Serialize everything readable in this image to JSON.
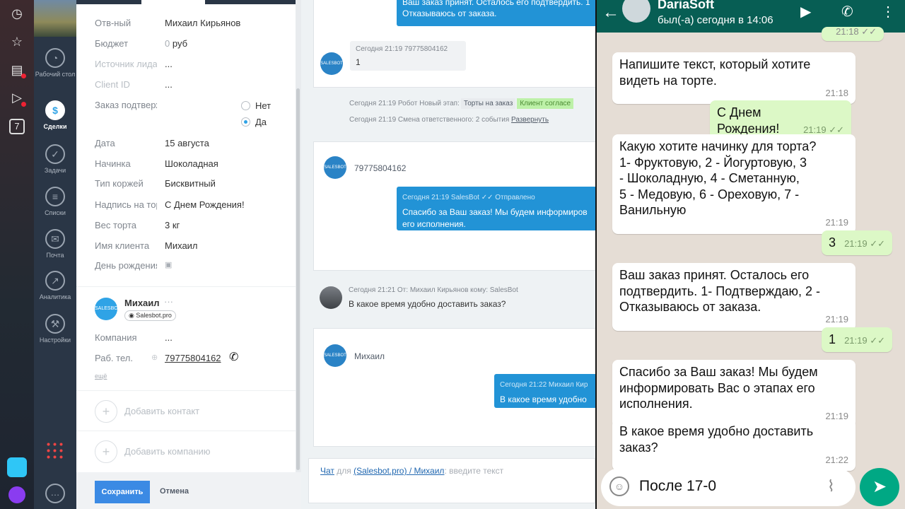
{
  "os_bar": {
    "icons": [
      "clock-icon",
      "star-icon",
      "news-icon",
      "play-icon",
      "calendar-icon"
    ],
    "calendar_day": "7"
  },
  "nav": {
    "items": [
      {
        "name": "desktop",
        "label": "Рабочий стол",
        "icon": "gauge-icon"
      },
      {
        "name": "deals",
        "label": "Сделки",
        "icon": "dollar-icon",
        "active": true
      },
      {
        "name": "tasks",
        "label": "Задачи",
        "icon": "check-icon"
      },
      {
        "name": "lists",
        "label": "Списки",
        "icon": "list-icon"
      },
      {
        "name": "mail",
        "label": "Почта",
        "icon": "envelope-icon"
      },
      {
        "name": "analytics",
        "label": "Аналитика",
        "icon": "chart-icon"
      },
      {
        "name": "settings",
        "label": "Настройки",
        "icon": "wrench-icon"
      }
    ]
  },
  "form": {
    "responsible": {
      "label": "Отв-ный",
      "value": "Михаил Кирьянов"
    },
    "budget": {
      "label": "Бюджет",
      "prefix": "0",
      "value": "руб"
    },
    "lead_source": {
      "label": "Источник лида",
      "value": "..."
    },
    "client_id": {
      "label": "Client ID",
      "value": "..."
    },
    "order_confirm": {
      "label": "Заказ подтвержден",
      "option_no": "Нет",
      "option_yes": "Да",
      "selected": "Да"
    },
    "date": {
      "label": "Дата",
      "value": "15 августа"
    },
    "filling": {
      "label": "Начинка",
      "value": "Шоколадная"
    },
    "cake_type": {
      "label": "Тип коржей",
      "value": "Бисквитный"
    },
    "inscription": {
      "label": "Надпись на торте",
      "value": "С Днем Рождения!"
    },
    "weight": {
      "label": "Вес торта",
      "value": "3 кг"
    },
    "client_name": {
      "label": "Имя клиента",
      "value": "Михаил"
    },
    "birthday": {
      "label": "День рождения",
      "icon": "calendar-small-icon"
    }
  },
  "contact": {
    "name": "Михаил",
    "badge": "Salesbot.pro",
    "company": {
      "label": "Компания",
      "value": "..."
    },
    "phone": {
      "label": "Раб. тел.",
      "value": "79775804162"
    },
    "more": "ещё"
  },
  "add": {
    "contact": "Добавить контакт",
    "company": "Добавить компанию"
  },
  "footer": {
    "save": "Сохранить",
    "cancel": "Отмена"
  },
  "feed": {
    "top_bubble": {
      "line1": "Ваш заказ принят. Осталось его подтвердить. 1",
      "line2": "Отказываюсь от заказа."
    },
    "msg1": {
      "meta": "Сегодня 21:19 79775804162",
      "text": "1"
    },
    "event1": {
      "text": "Сегодня 21:19 Робот  Новый этап:",
      "tag1": "Торты на заказ",
      "tag2": "Клиент согласе"
    },
    "event2": {
      "text": "Сегодня 21:19 Смена ответственного: 2 события",
      "link": "Развернуть"
    },
    "panel2": {
      "sender": "79775804162",
      "meta": "Сегодня 21:19 SalesBot  ✓✓ Отправлено",
      "line1": "Спасибо за Ваш заказ! Мы будем информиров",
      "line2": "его исполнения."
    },
    "comment": {
      "meta": "Сегодня 21:21 От: Михаил Кирьянов кому: SalesBot",
      "text": "В какое время удобно доставить заказ?"
    },
    "panel3": {
      "sender": "Михаил",
      "meta": "Сегодня 21:22 Михаил Кир",
      "text": "В какое время удобно"
    },
    "chat_input": {
      "chat": "Чат",
      "for": "для",
      "target": "(Salesbot.pro) / Михаил",
      "placeholder": ": введите текст"
    }
  },
  "whatsapp": {
    "name": "DariaSoft",
    "status": "был(-а) сегодня в 14:06",
    "messages": [
      {
        "dir": "in",
        "lines": [
          "Напишите текст, который хотите",
          "видеть на торте."
        ],
        "time": "21:18"
      },
      {
        "dir": "out",
        "lines": [
          "С Днем Рождения!"
        ],
        "time": "21:19 ✓✓"
      },
      {
        "dir": "in",
        "lines": [
          "Какую хотите начинку для торта?",
          "1- Фруктовую, 2 - Йогуртовую, 3",
          "- Шоколадную,  4 - Сметанную,",
          "5 - Медовую, 6 - Ореховую, 7 -",
          "Ванильную"
        ],
        "time": "21:19"
      },
      {
        "dir": "out",
        "lines": [
          "3"
        ],
        "time": "21:19 ✓✓"
      },
      {
        "dir": "in",
        "lines": [
          "Ваш заказ принят. Осталось его",
          "подтвердить. 1- Подтверждаю, 2 -",
          "Отказываюсь от заказа."
        ],
        "time": "21:19"
      },
      {
        "dir": "out",
        "lines": [
          "1"
        ],
        "time": "21:19 ✓✓"
      },
      {
        "dir": "in",
        "lines": [
          "Спасибо за Ваш заказ! Мы будем",
          "информировать Вас о этапах его",
          "исполнения."
        ],
        "time": "21:19"
      },
      {
        "dir": "in",
        "lines": [
          "В какое время удобно доставить",
          "заказ?"
        ],
        "time": "21:22"
      }
    ],
    "prev_time": "21:18 ✓✓",
    "input_value": "После 17-0"
  },
  "colors": {
    "accent": "#2293d6",
    "wa_header": "#075e54",
    "wa_out": "#dcf8c6",
    "wa_send": "#00a884"
  }
}
